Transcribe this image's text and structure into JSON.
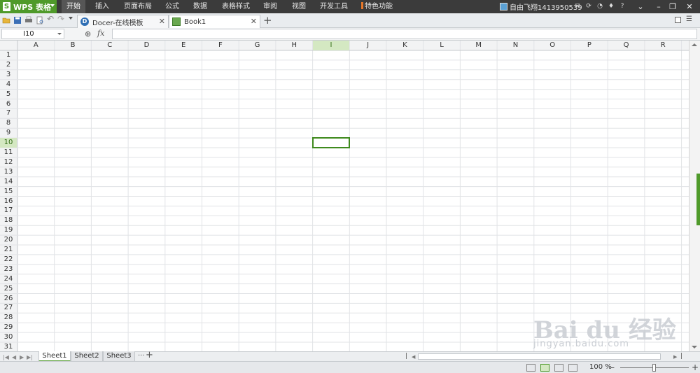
{
  "app": {
    "name": "WPS 表格",
    "logo_glyph": "S",
    "accent_color": "#4f9a2a"
  },
  "menu": {
    "items": [
      {
        "label": "开始",
        "active": true
      },
      {
        "label": "插入",
        "active": false
      },
      {
        "label": "页面布局",
        "active": false
      },
      {
        "label": "公式",
        "active": false
      },
      {
        "label": "数据",
        "active": false
      },
      {
        "label": "表格样式",
        "active": false
      },
      {
        "label": "审阅",
        "active": false
      },
      {
        "label": "视图",
        "active": false
      },
      {
        "label": "开发工具",
        "active": false
      },
      {
        "label": "特色功能",
        "active": false
      }
    ]
  },
  "user": {
    "name": "自由飞翔1413950539"
  },
  "help_glyph": "?",
  "tabs": [
    {
      "label": "Docer-在线模板",
      "icon": "docer-icon",
      "active": false
    },
    {
      "label": "Book1",
      "icon": "spreadsheet-icon",
      "active": true
    }
  ],
  "formula_bar": {
    "cell_reference": "I10",
    "fx_label": "fx",
    "formula_value": ""
  },
  "grid": {
    "columns": [
      "A",
      "B",
      "C",
      "D",
      "E",
      "F",
      "G",
      "H",
      "I",
      "J",
      "K",
      "L",
      "M",
      "N",
      "O",
      "P",
      "Q",
      "R"
    ],
    "row_count": 31,
    "selected_column": "I",
    "selected_row": 10,
    "selection_color": "#3f8a1e"
  },
  "sheets": [
    {
      "label": "Sheet1",
      "active": true
    },
    {
      "label": "Sheet2",
      "active": false
    },
    {
      "label": "Sheet3",
      "active": false
    }
  ],
  "status": {
    "zoom": "100 %"
  },
  "watermark": {
    "brand": "Bai  du 经验",
    "url": "jingyan.baidu.com"
  }
}
